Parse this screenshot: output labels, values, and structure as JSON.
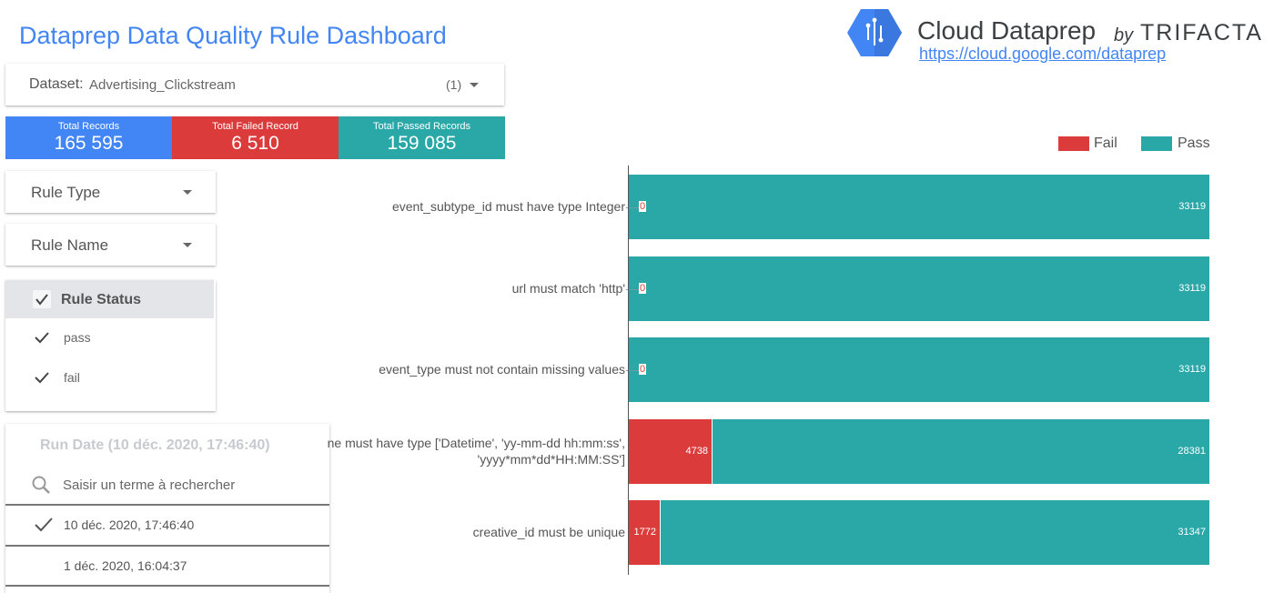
{
  "header": {
    "title": "Dataprep Data Quality Rule Dashboard",
    "brand": {
      "name": "Cloud Dataprep",
      "by": "by",
      "company": "TRIFACTA",
      "link": "https://cloud.google.com/dataprep",
      "icon": "google-cloud-dataprep-hexagon-icon"
    }
  },
  "dataset_filter": {
    "label": "Dataset:",
    "value": "Advertising_Clickstream",
    "count": "(1)"
  },
  "kpis": [
    {
      "label": "Total Records",
      "value": "165 595",
      "color": "#4285f4"
    },
    {
      "label": "Total Failed Record",
      "value": "6 510",
      "color": "#dc3b3b"
    },
    {
      "label": "Total Passed Records",
      "value": "159 085",
      "color": "#2aa8a8"
    }
  ],
  "filters": {
    "rule_type": "Rule Type",
    "rule_name": "Rule Name"
  },
  "rule_status": {
    "title": "Rule Status",
    "options": [
      {
        "label": "pass",
        "checked": true
      },
      {
        "label": "fail",
        "checked": true
      }
    ]
  },
  "run_date": {
    "title": "Run Date (10 déc. 2020, 17:46:40)",
    "search_placeholder": "Saisir un terme à rechercher",
    "options": [
      {
        "label": "10 déc. 2020, 17:46:40",
        "checked": true
      },
      {
        "label": "1 déc. 2020, 16:04:37",
        "checked": false
      }
    ]
  },
  "chart_data": {
    "type": "bar",
    "orientation": "horizontal",
    "stacked": true,
    "title": "",
    "xlabel": "",
    "ylabel": "",
    "legend_position": "top-right",
    "categories": [
      [
        "event_subtype_id must have type Integer"
      ],
      [
        "url must match 'http'"
      ],
      [
        "event_type must not contain missing values"
      ],
      [
        "ne must have type ['Datetime', 'yy-mm-dd hh:mm:ss',",
        "'yyyy*mm*dd*HH:MM:SS']"
      ],
      [
        "creative_id must be unique"
      ]
    ],
    "series": [
      {
        "name": "Fail",
        "color": "#dc3b3b",
        "values": [
          0,
          0,
          0,
          4738,
          1772
        ]
      },
      {
        "name": "Pass",
        "color": "#2aa8a8",
        "values": [
          33119,
          33119,
          33119,
          28381,
          31347
        ]
      }
    ]
  }
}
